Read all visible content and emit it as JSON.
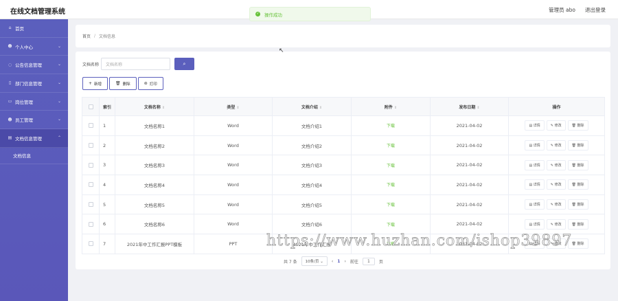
{
  "app": {
    "title": "在线文档管理系统"
  },
  "header": {
    "user": "管理员 abo",
    "logout": "退出登录"
  },
  "toast": {
    "message": "操作成功"
  },
  "sidebar": {
    "items": [
      {
        "label": "首页",
        "icon": "home-icon",
        "glyph": "⌂"
      },
      {
        "label": "个人中心",
        "icon": "user-icon",
        "glyph": "☻"
      },
      {
        "label": "公告信息管理",
        "icon": "notice-icon",
        "glyph": "◌"
      },
      {
        "label": "部门信息管理",
        "icon": "department-icon",
        "glyph": "▯"
      },
      {
        "label": "岗位管理",
        "icon": "post-icon",
        "glyph": "▭"
      },
      {
        "label": "员工管理",
        "icon": "staff-icon",
        "glyph": "☻"
      },
      {
        "label": "文档信息管理",
        "icon": "document-icon",
        "glyph": "▤"
      }
    ],
    "submenu": {
      "label": "文档信息"
    }
  },
  "breadcrumb": {
    "home": "首页",
    "separator": "/",
    "current": "文档信息"
  },
  "search": {
    "label": "文档名称",
    "placeholder": "文档名称"
  },
  "actions": {
    "add": "新增",
    "delete": "删除",
    "print": "打印"
  },
  "table": {
    "headers": {
      "index": "索引",
      "name": "文档名称",
      "type": "类型",
      "intro": "文档介绍",
      "attachment": "附件",
      "date": "发布日期",
      "ops": "操作"
    },
    "op_labels": {
      "detail": "详情",
      "edit": "修改",
      "delete": "删除"
    },
    "rows": [
      {
        "index": "1",
        "name": "文档名称1",
        "type": "Word",
        "intro": "文档介绍1",
        "attachment": "下载",
        "date": "2021-04-02"
      },
      {
        "index": "2",
        "name": "文档名称2",
        "type": "Word",
        "intro": "文档介绍2",
        "attachment": "下载",
        "date": "2021-04-02"
      },
      {
        "index": "3",
        "name": "文档名称3",
        "type": "Word",
        "intro": "文档介绍3",
        "attachment": "下载",
        "date": "2021-04-02"
      },
      {
        "index": "4",
        "name": "文档名称4",
        "type": "Word",
        "intro": "文档介绍4",
        "attachment": "下载",
        "date": "2021-04-02"
      },
      {
        "index": "5",
        "name": "文档名称5",
        "type": "Word",
        "intro": "文档介绍5",
        "attachment": "下载",
        "date": "2021-04-02"
      },
      {
        "index": "6",
        "name": "文档名称6",
        "type": "Word",
        "intro": "文档介绍6",
        "attachment": "下载",
        "date": "2021-04-02"
      },
      {
        "index": "7",
        "name": "2021年中工作汇报PPT模板",
        "type": "PPT",
        "intro": "2021年中工作汇报",
        "attachment": "下载",
        "date": "2021-04-02"
      }
    ]
  },
  "pagination": {
    "total": "共 7 条",
    "page_size": "10条/页",
    "current_page": "1",
    "goto_label": "前往",
    "goto_value": "1",
    "page_suffix": "页"
  },
  "watermark": {
    "text": "https://www.huzhan.com/ishop39897"
  },
  "colors": {
    "sidebar": "#5b5fbd",
    "success": "#67c23a",
    "accent": "#5b5fbd"
  }
}
